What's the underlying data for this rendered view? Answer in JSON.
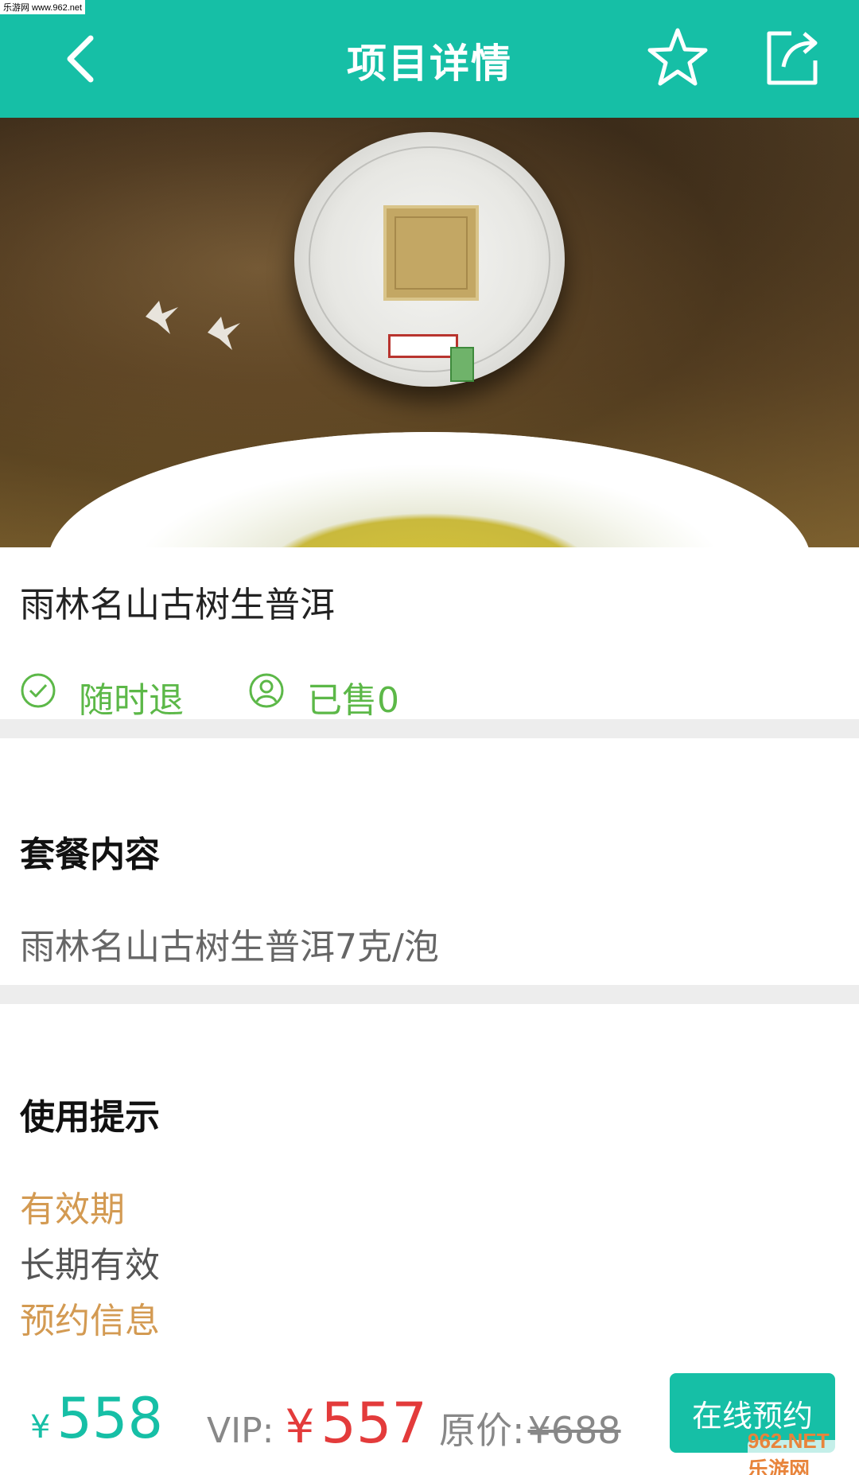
{
  "watermark": {
    "top_left": "乐游网 www.962.net",
    "bottom_right": "962.NET 乐游网"
  },
  "header": {
    "title": "项目详情",
    "back_icon": "chevron-left-icon",
    "favorite_icon": "star-outline-icon",
    "share_icon": "share-icon"
  },
  "hero": {
    "image": "pu'er tea cake above a cup of tea"
  },
  "item": {
    "title": "雨林名山古树生普洱",
    "tags": [
      {
        "icon": "check-circle-icon",
        "label": "随时退"
      },
      {
        "icon": "user-circle-icon",
        "label": "已售0"
      }
    ]
  },
  "package": {
    "heading": "套餐内容",
    "content": "雨林名山古树生普洱7克/泡"
  },
  "tips": {
    "heading": "使用提示",
    "validity_label": "有效期",
    "validity_value": "长期有效",
    "booking_label": "预约信息"
  },
  "bottom": {
    "price_symbol": "¥",
    "price": "558",
    "vip_label": "VIP:",
    "vip_symbol": "¥",
    "vip_price": "557",
    "original_label": "原价:",
    "original_price": "¥688",
    "book_button": "在线预约"
  },
  "colors": {
    "primary": "#16bfa6",
    "tag_green": "#5cb848",
    "tip_orange": "#d39a52",
    "vip_red": "#e33b3b"
  }
}
